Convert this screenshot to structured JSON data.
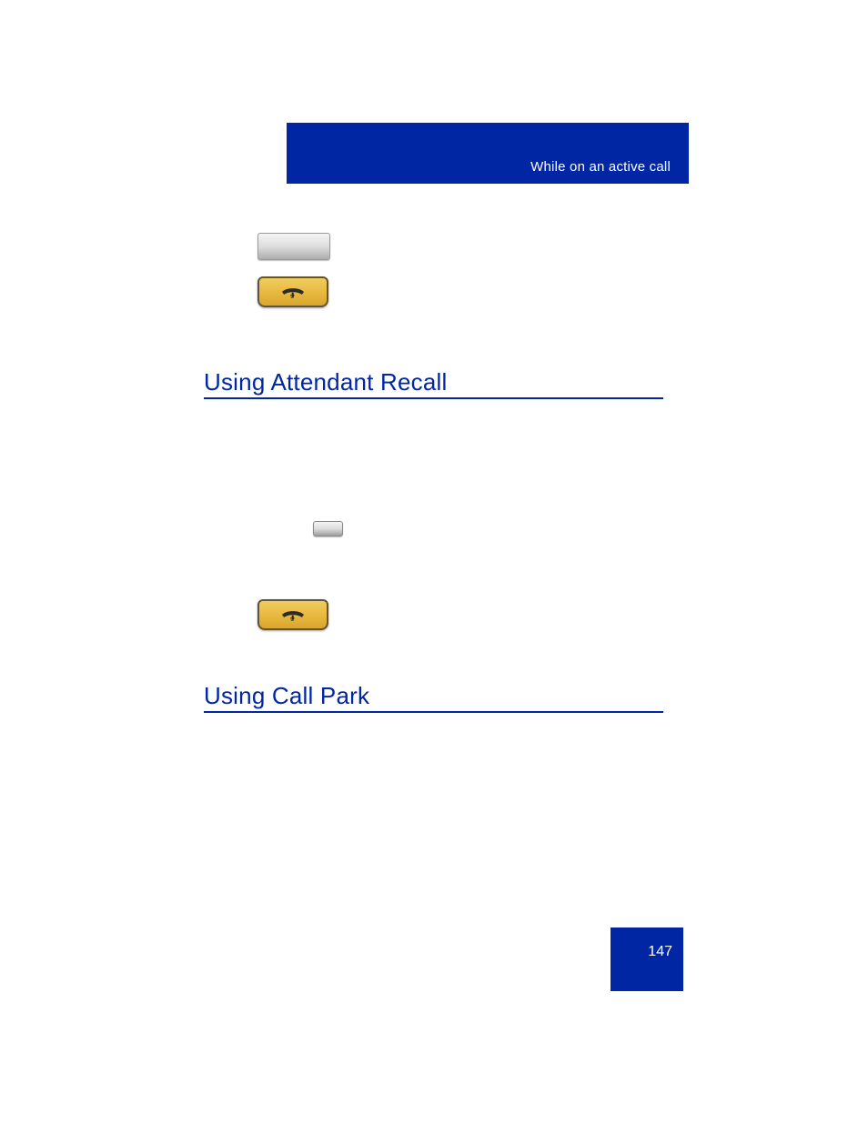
{
  "topbar": {
    "label": "While on an active call"
  },
  "headings": {
    "attendant_recall": "Using Attendant Recall",
    "call_park": "Using Call Park"
  },
  "icons": {
    "soft_key": "soft-key",
    "mini_key": "soft-key-mini",
    "goodbye": "goodbye"
  },
  "page_number": "147"
}
